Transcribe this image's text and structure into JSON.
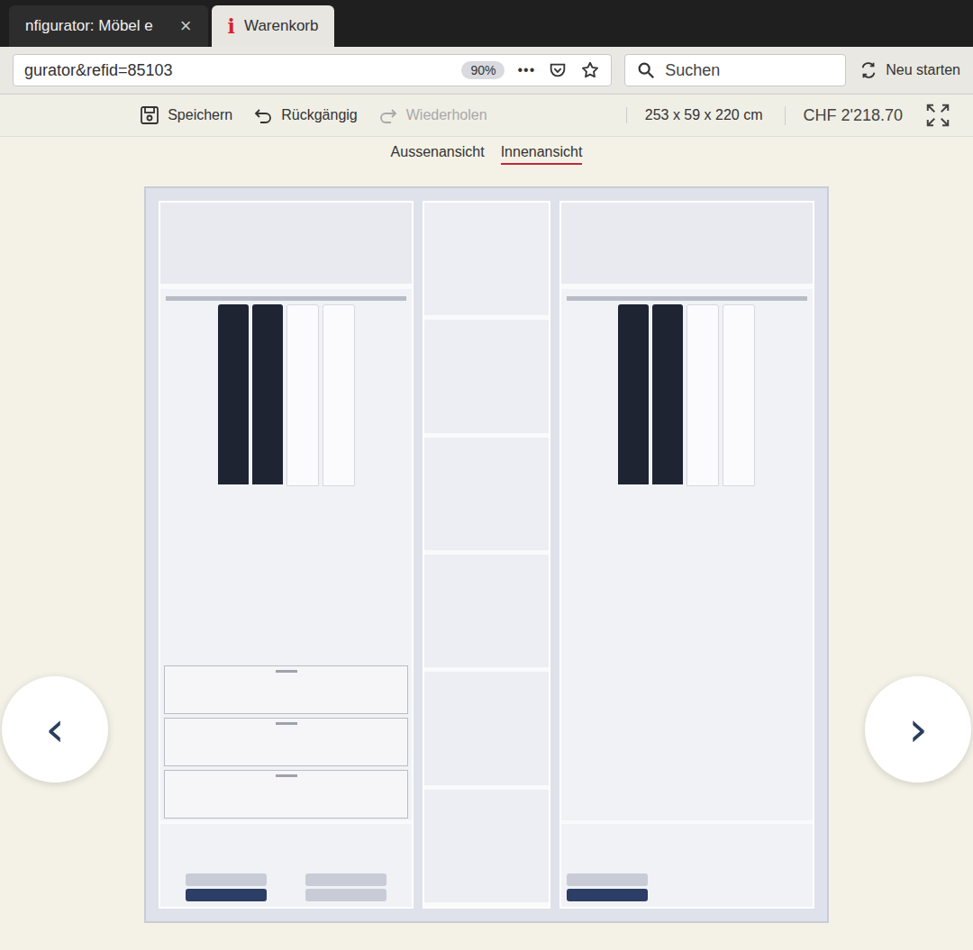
{
  "browser": {
    "tabs": [
      {
        "label": "nfigurator: Möbel e",
        "close": "×",
        "selected": true
      },
      {
        "label": "Warenkorb",
        "logo": "i",
        "selected": false
      }
    ],
    "address": "gurator&refid=85103",
    "zoom": "90%",
    "menu": "•••",
    "search": {
      "placeholder": "Suchen"
    },
    "restart": "Neu starten"
  },
  "toolbar": {
    "actions": [
      {
        "label": "Speichern",
        "kind": "save",
        "disabled": false
      },
      {
        "label": "Rückgängig",
        "kind": "undo",
        "disabled": false
      },
      {
        "label": "Wiederholen",
        "kind": "redo",
        "disabled": true
      }
    ],
    "dimensions": "253 x 59 x 220 cm",
    "price": "CHF 2'218.70"
  },
  "views": [
    {
      "label": "Aussenansicht",
      "selected": false
    },
    {
      "label": "Innenansicht",
      "selected": true
    }
  ],
  "carousel": {
    "prev": "‹",
    "next": "›"
  }
}
